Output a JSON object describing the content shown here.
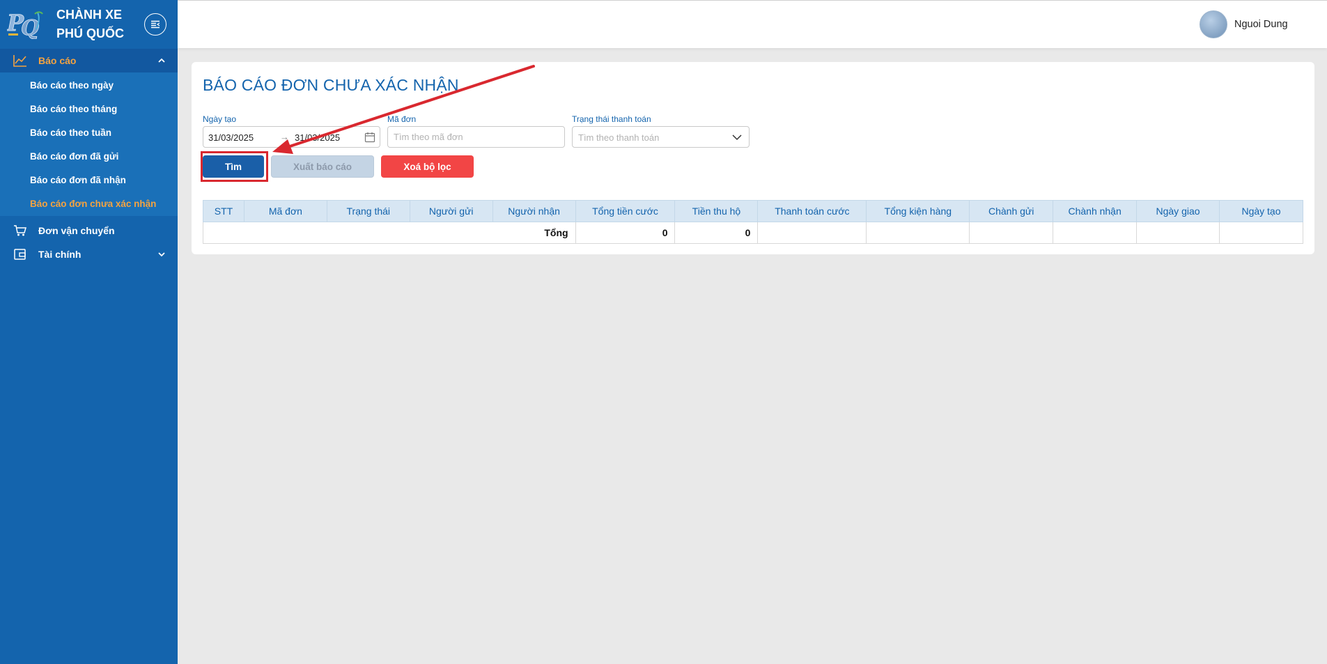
{
  "brand": {
    "title": "CHÀNH XE PHÚ QUỐC",
    "logo_text": "PQ"
  },
  "sidebar": {
    "groups": [
      {
        "label": "Báo cáo",
        "icon": "line-chart-icon"
      },
      {
        "label": "Đơn vận chuyển",
        "icon": "cart-icon"
      },
      {
        "label": "Tài chính",
        "icon": "wallet-icon"
      }
    ],
    "report_items": [
      {
        "label": "Báo cáo theo ngày"
      },
      {
        "label": "Báo cáo theo tháng"
      },
      {
        "label": "Báo cáo theo tuần"
      },
      {
        "label": "Báo cáo đơn đã gửi"
      },
      {
        "label": "Báo cáo đơn đã nhận"
      },
      {
        "label": "Báo cáo đơn chưa xác nhận"
      }
    ],
    "active_item": "Báo cáo đơn chưa xác nhận"
  },
  "header": {
    "user_name": "Nguoi Dung"
  },
  "page": {
    "title": "BÁO CÁO ĐƠN CHƯA XÁC NHẬN",
    "filters": {
      "created_date_label": "Ngày tạo",
      "date_from": "31/03/2025",
      "date_arrow": "→",
      "date_to": "31/03/2025",
      "order_code_label": "Mã đơn",
      "order_code_placeholder": "Tìm theo mã đơn",
      "payment_status_label": "Trạng thái thanh toán",
      "payment_status_placeholder": "Tìm theo thanh toán"
    },
    "buttons": {
      "search": "Tìm",
      "export": "Xuất báo cáo",
      "clear": "Xoá bộ lọc"
    }
  },
  "table": {
    "columns": [
      "STT",
      "Mã đơn",
      "Trạng thái",
      "Người gửi",
      "Người nhận",
      "Tổng tiền cước",
      "Tiền thu hộ",
      "Thanh toán cước",
      "Tổng kiện hàng",
      "Chành gửi",
      "Chành nhận",
      "Ngày giao",
      "Ngày tạo"
    ],
    "total_row": {
      "label": "Tổng",
      "total_fee": "0",
      "cod": "0"
    }
  },
  "colors": {
    "sidebar": "#1464ad",
    "accent": "#f5a340",
    "danger": "#f24545",
    "annotation": "#d9282f"
  }
}
